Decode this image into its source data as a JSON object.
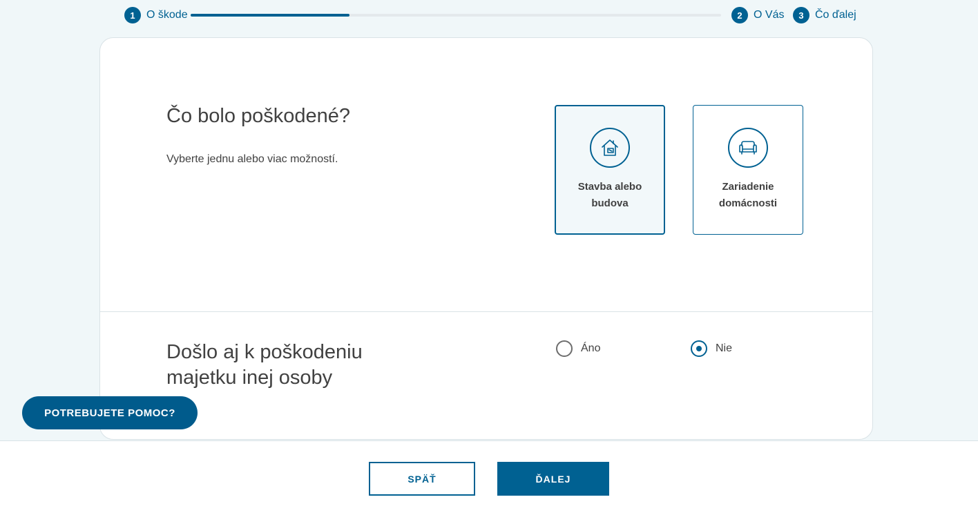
{
  "stepper": {
    "progress": 0.3,
    "steps": [
      {
        "number": "1",
        "label": "O škode",
        "state": "active"
      },
      {
        "number": "2",
        "label": "O Vás",
        "state": "pending"
      },
      {
        "number": "3",
        "label": "Čo ďalej",
        "state": "pending"
      }
    ]
  },
  "question_damage": {
    "title": "Čo bolo poškodené?",
    "subtitle": "Vyberte jednu alebo viac možností.",
    "options": [
      {
        "label": "Stavba alebo budova",
        "icon": "house-icon",
        "selected": true
      },
      {
        "label": "Zariadenie domácnosti",
        "icon": "armchair-icon",
        "selected": false
      }
    ]
  },
  "question_third_party": {
    "title": "Došlo aj k poškodeniu majetku inej osoby",
    "options": [
      {
        "label": "Áno",
        "checked": false
      },
      {
        "label": "Nie",
        "checked": true
      }
    ]
  },
  "help": {
    "label": "POTREBUJETE POMOC?"
  },
  "footer": {
    "back_label": "SPÄŤ",
    "next_label": "ĎALEJ"
  },
  "colors": {
    "primary": "#006192",
    "background": "#f0f7f9",
    "text": "#414141"
  }
}
